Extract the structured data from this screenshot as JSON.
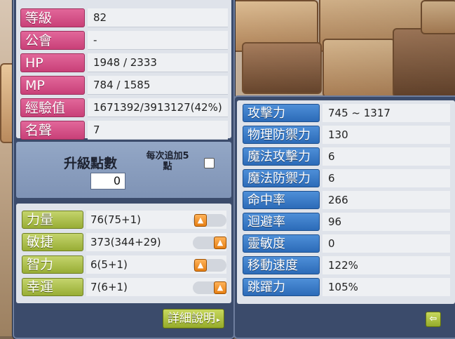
{
  "basic_stats": [
    {
      "label": "等級",
      "value": "82"
    },
    {
      "label": "公會",
      "value": "-"
    },
    {
      "label": "HP",
      "value": "1948 / 2333"
    },
    {
      "label": "MP",
      "value": "784 / 1585"
    },
    {
      "label": "經驗值",
      "value": "1671392/3913127(42%)"
    },
    {
      "label": "名聲",
      "value": "7"
    }
  ],
  "ability_points": {
    "title": "升級點數",
    "value": "0",
    "auto_label_line1": "每次追加5",
    "auto_label_line2": "點",
    "auto_checked": false
  },
  "primary_stats": [
    {
      "label": "力量",
      "value": "76(75+1)"
    },
    {
      "label": "敏捷",
      "value": "373(344+29)"
    },
    {
      "label": "智力",
      "value": "6(5+1)"
    },
    {
      "label": "幸運",
      "value": "7(6+1)"
    }
  ],
  "detail_button": {
    "label": "詳細說明",
    "arrow": "▸"
  },
  "detail_stats": [
    {
      "label": "攻擊力",
      "value": "745 ~ 1317"
    },
    {
      "label": "物理防禦力",
      "value": "130"
    },
    {
      "label": "魔法攻擊力",
      "value": "6"
    },
    {
      "label": "魔法防禦力",
      "value": "6"
    },
    {
      "label": "命中率",
      "value": "266"
    },
    {
      "label": "迴避率",
      "value": "96"
    },
    {
      "label": "靈敏度",
      "value": "0"
    },
    {
      "label": "移動速度",
      "value": "122%"
    },
    {
      "label": "跳躍力",
      "value": "105%"
    }
  ],
  "icons": {
    "up": "▲",
    "back": "⇦"
  },
  "colors": {
    "window": "#3b4b6b",
    "basic_label": "#d44f86",
    "primary_label": "#a9bd47",
    "detail_label": "#3a7bc8",
    "up_button": "#f0901e"
  }
}
